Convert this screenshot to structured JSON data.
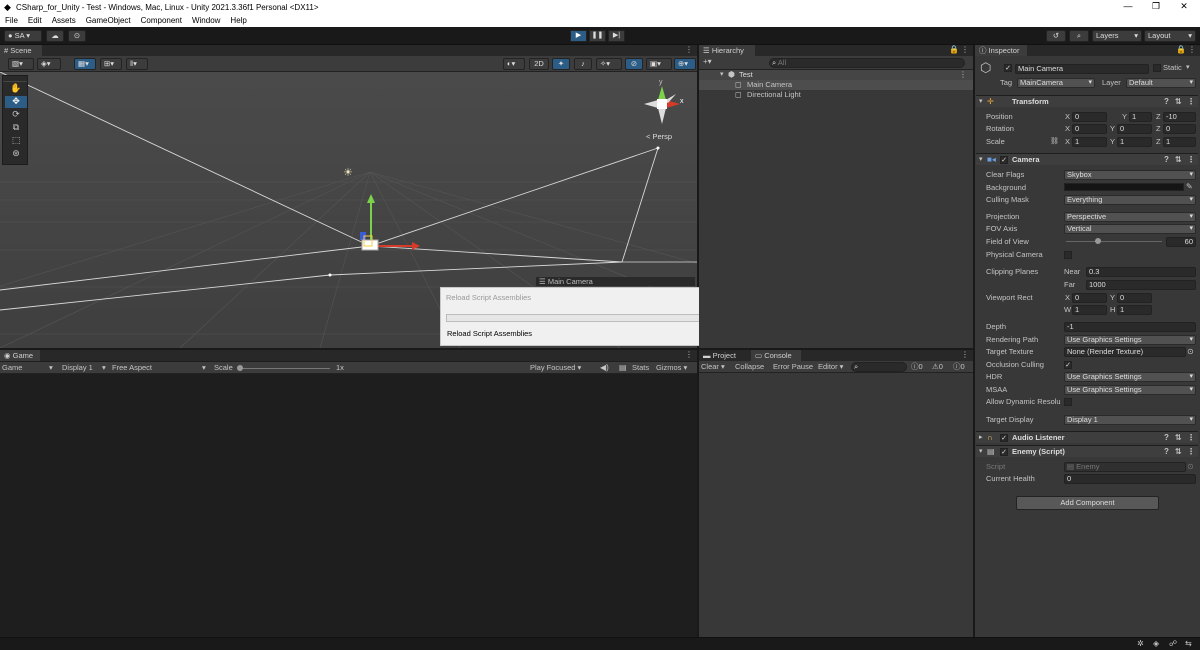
{
  "window": {
    "title": "CSharp_for_Unity - Test - Windows, Mac, Linux - Unity 2021.3.36f1 Personal <DX11>",
    "minimize": "—",
    "restore": "❐",
    "close": "✕"
  },
  "menu": [
    "File",
    "Edit",
    "Assets",
    "GameObject",
    "Component",
    "Window",
    "Help"
  ],
  "toolbar": {
    "account": "SA",
    "layers": "Layers",
    "layout": "Layout"
  },
  "scene": {
    "tab": "Scene",
    "mode_2d": "2D",
    "persp": "< Persp",
    "camera_label": "Main Camera",
    "gizmo_y": "y",
    "gizmo_x": "x"
  },
  "dialog": {
    "title": "Reload Script Assemblies",
    "message": "Reload Script Assemblies",
    "progress": 0
  },
  "hierarchy": {
    "tab": "Hierarchy",
    "search_placeholder": "All",
    "scene": "Test",
    "items": [
      "Main Camera",
      "Directional Light"
    ]
  },
  "inspector": {
    "tab": "Inspector",
    "object_name": "Main Camera",
    "static_label": "Static",
    "tag_label": "Tag",
    "tag_value": "MainCamera",
    "layer_label": "Layer",
    "layer_value": "Default",
    "transform": {
      "title": "Transform",
      "rows": [
        {
          "label": "Position",
          "x": "0",
          "y": "1",
          "z": "-10"
        },
        {
          "label": "Rotation",
          "x": "0",
          "y": "0",
          "z": "0"
        },
        {
          "label": "Scale",
          "x": "1",
          "y": "1",
          "z": "1"
        }
      ]
    },
    "camera": {
      "title": "Camera",
      "clear_flags_label": "Clear Flags",
      "clear_flags": "Skybox",
      "background_label": "Background",
      "culling_mask_label": "Culling Mask",
      "culling_mask": "Everything",
      "projection_label": "Projection",
      "projection": "Perspective",
      "fov_axis_label": "FOV Axis",
      "fov_axis": "Vertical",
      "fov_label": "Field of View",
      "fov": "60",
      "physical_label": "Physical Camera",
      "clipping_label": "Clipping Planes",
      "near_label": "Near",
      "near": "0.3",
      "far_label": "Far",
      "far": "1000",
      "viewport_label": "Viewport Rect",
      "vp_x": "0",
      "vp_y": "0",
      "vp_w": "1",
      "vp_h": "1",
      "depth_label": "Depth",
      "depth": "-1",
      "rendering_path_label": "Rendering Path",
      "rendering_path": "Use Graphics Settings",
      "target_texture_label": "Target Texture",
      "target_texture": "None (Render Texture)",
      "occlusion_label": "Occlusion Culling",
      "hdr_label": "HDR",
      "hdr": "Use Graphics Settings",
      "msaa_label": "MSAA",
      "msaa": "Use Graphics Settings",
      "dynamic_label": "Allow Dynamic Resolu",
      "target_display_label": "Target Display",
      "target_display": "Display 1"
    },
    "audio_listener": "Audio Listener",
    "enemy": {
      "title": "Enemy (Script)",
      "script_label": "Script",
      "script_value": "Enemy",
      "health_label": "Current Health",
      "health_value": "0"
    },
    "add_component": "Add Component"
  },
  "game": {
    "tab": "Game",
    "mode": "Game",
    "display": "Display 1",
    "aspect": "Free Aspect",
    "scale_label": "Scale",
    "scale_value": "1x",
    "play_focused": "Play Focused",
    "stats": "Stats",
    "gizmos": "Gizmos"
  },
  "console": {
    "project_tab": "Project",
    "console_tab": "Console",
    "clear": "Clear",
    "collapse": "Collapse",
    "error_pause": "Error Pause",
    "editor": "Editor",
    "count_log": "0",
    "count_warn": "0",
    "count_err": "0"
  },
  "colors": {
    "accent": "#2c5d87",
    "panel": "#383838",
    "dark": "#191919",
    "scene_bg": "#434343"
  }
}
